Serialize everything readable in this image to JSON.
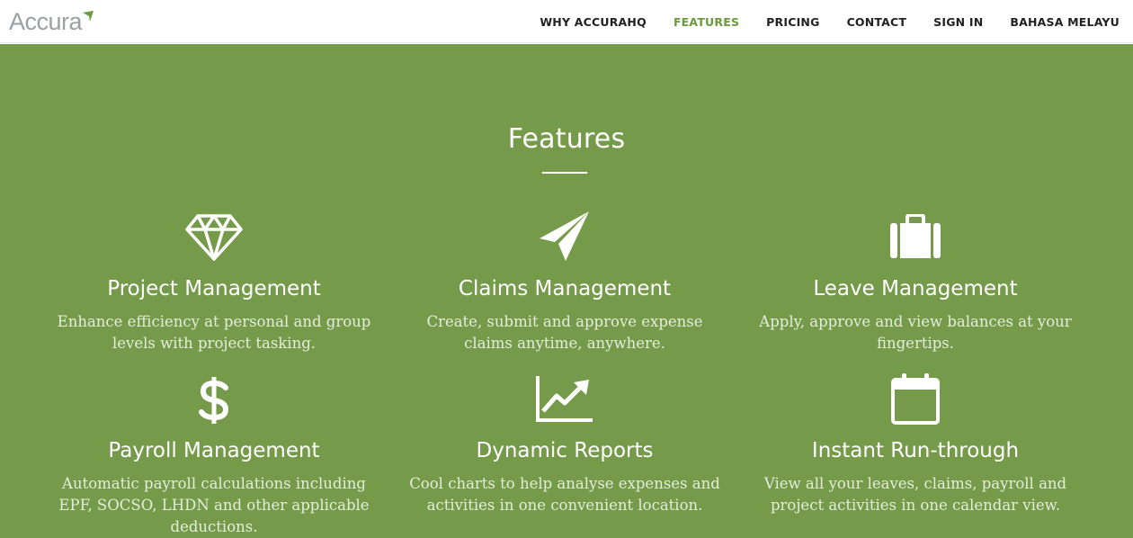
{
  "brand": {
    "logo_text": "Accura"
  },
  "nav": {
    "items": [
      {
        "label": "WHY ACCURAHQ",
        "active": false
      },
      {
        "label": "FEATURES",
        "active": true
      },
      {
        "label": "PRICING",
        "active": false
      },
      {
        "label": "CONTACT",
        "active": false
      },
      {
        "label": "SIGN IN",
        "active": false
      },
      {
        "label": "BAHASA MELAYU",
        "active": false
      }
    ]
  },
  "features_section": {
    "title": "Features",
    "items": [
      {
        "icon": "diamond-icon",
        "title": "Project Management",
        "description": "Enhance efficiency at personal and group levels with project tasking."
      },
      {
        "icon": "paper-plane-icon",
        "title": "Claims Management",
        "description": "Create, submit and approve expense claims anytime, anywhere."
      },
      {
        "icon": "suitcase-icon",
        "title": "Leave Management",
        "description": "Apply, approve and view balances at your fingertips."
      },
      {
        "icon": "dollar-icon",
        "title": "Payroll Management",
        "description": "Automatic payroll calculations including EPF, SOCSO, LHDN and other applicable deductions."
      },
      {
        "icon": "line-chart-icon",
        "title": "Dynamic Reports",
        "description": "Cool charts to help analyse expenses and activities in one convenient location."
      },
      {
        "icon": "calendar-icon",
        "title": "Instant Run-through",
        "description": "View all your leaves, claims, payroll and project activities in one calendar view."
      }
    ]
  },
  "colors": {
    "hero_background": "#759b4a",
    "nav_active": "#6b9a3f",
    "nav_text": "#222222",
    "logo_text": "#9aa0a3",
    "logo_accent": "#6b9a3f"
  }
}
